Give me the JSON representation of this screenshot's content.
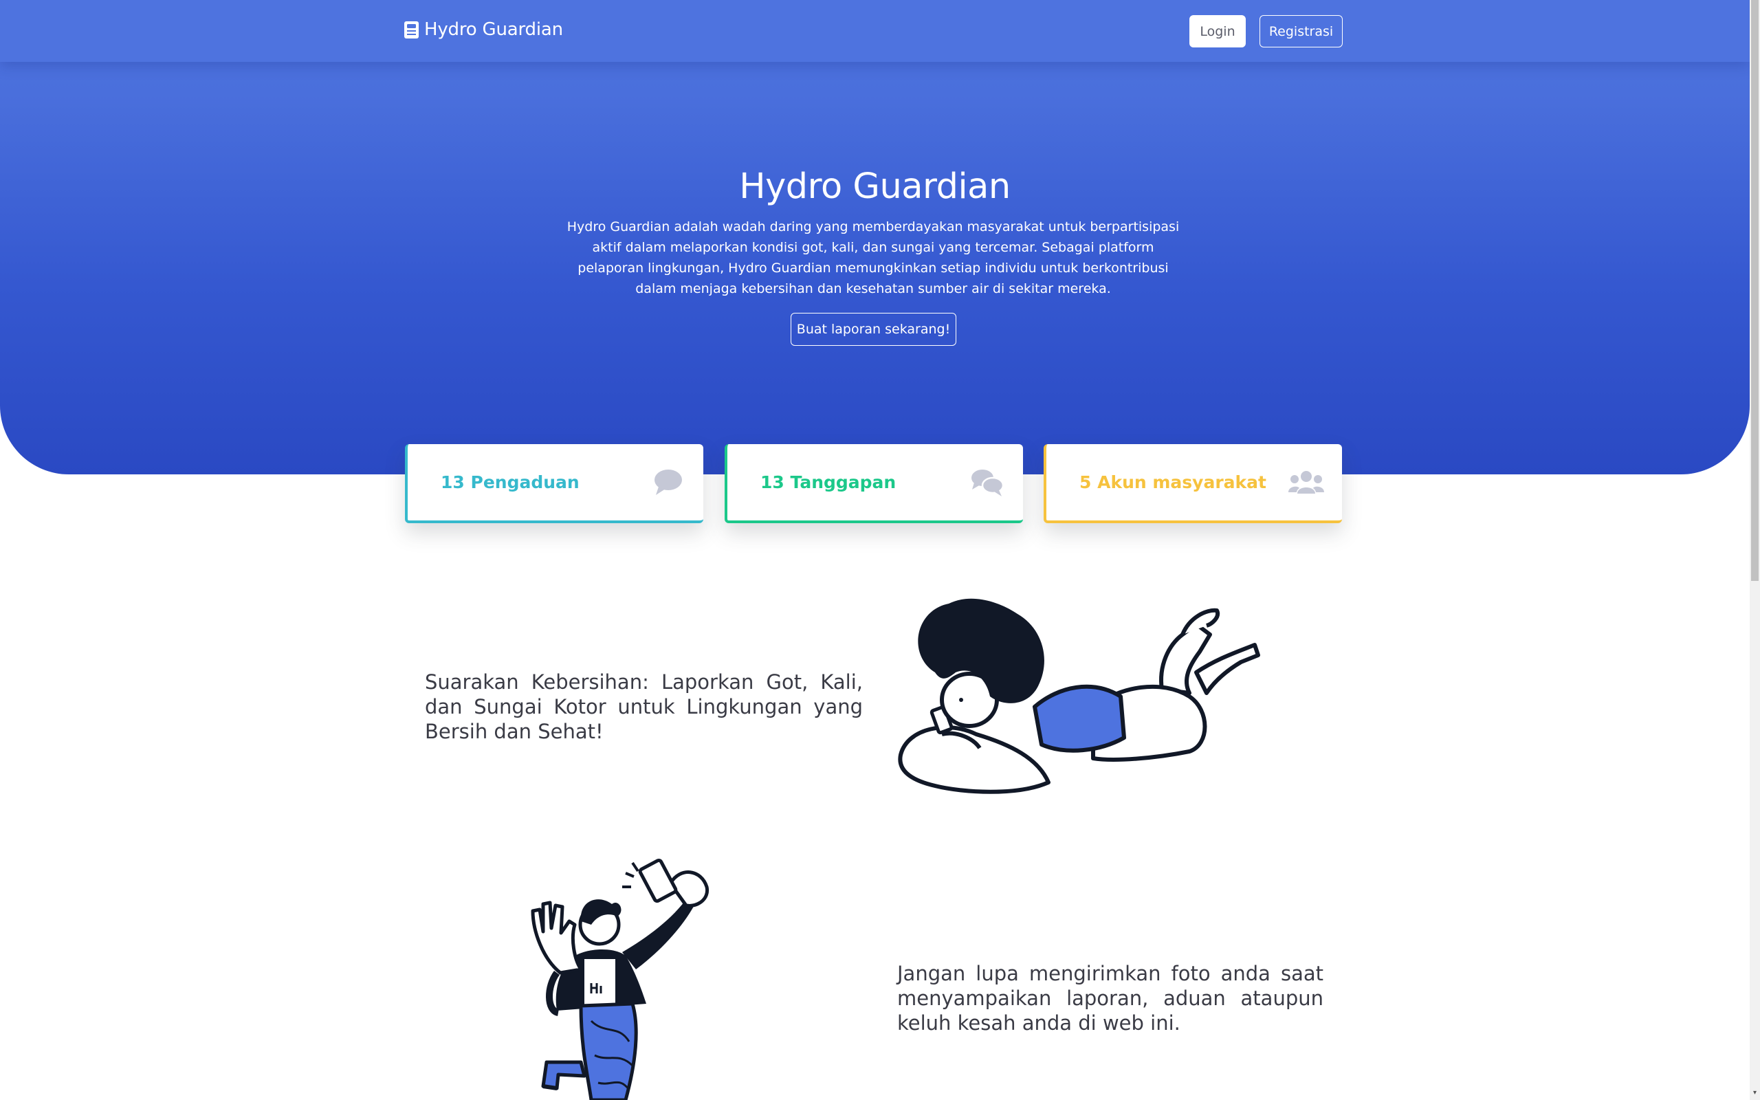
{
  "navbar": {
    "brand": "Hydro Guardian",
    "login_label": "Login",
    "register_label": "Registrasi"
  },
  "hero": {
    "title": "Hydro Guardian",
    "description": "Hydro Guardian adalah wadah daring yang memberdayakan masyarakat untuk berpartisipasi aktif dalam melaporkan kondisi got, kali, dan sungai yang tercemar. Sebagai platform pelaporan lingkungan, Hydro Guardian memungkinkan setiap individu untuk berkontribusi dalam menjaga kebersihan dan kesehatan sumber air di sekitar mereka.",
    "cta_label": "Buat laporan sekarang!"
  },
  "stats": [
    {
      "label": "13 Pengaduan",
      "icon": "comment-icon",
      "color": "#36b9cc"
    },
    {
      "label": "13 Tanggapan",
      "icon": "comments-icon",
      "color": "#1cc88a"
    },
    {
      "label": "5 Akun masyarakat",
      "icon": "users-icon",
      "color": "#f6c23e"
    }
  ],
  "sections": [
    {
      "text": "Suarakan Kebersihan: Laporkan Got, Kali, dan Sungai Kotor untuk Lingkungan yang Bersih dan Sehat!",
      "illustration": "person-lying-with-phone-illustration"
    },
    {
      "text": "Jangan lupa mengirimkan foto anda saat menyampaikan laporan, aduan ataupun keluh kesah anda di web ini.",
      "illustration": "person-taking-selfie-illustration"
    }
  ],
  "colors": {
    "primary": "#4e73df",
    "info": "#36b9cc",
    "success": "#1cc88a",
    "warning": "#f6c23e",
    "icon_gray": "#c5c8d6"
  }
}
